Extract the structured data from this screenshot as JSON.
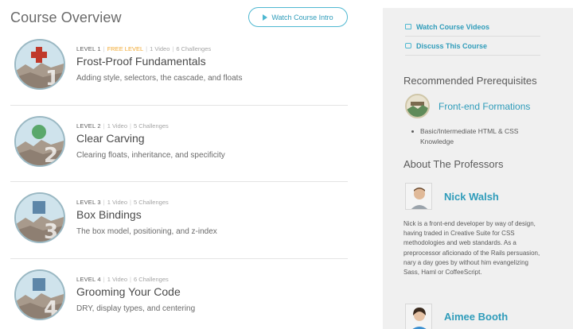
{
  "header": {
    "title": "Course Overview",
    "watch_intro_label": "Watch Course Intro"
  },
  "levels": [
    {
      "level": "LEVEL 1",
      "free": "FREE LEVEL",
      "videos": "1 Video",
      "challenges": "6 Challenges",
      "title": "Frost-Proof Fundamentals",
      "description": "Adding style, selectors, the cascade, and floats",
      "badge_icon": "red-cross-icon",
      "badge_number": "1",
      "badge_color": "#c0392b"
    },
    {
      "level": "LEVEL 2",
      "videos": "1 Video",
      "challenges": "5 Challenges",
      "title": "Clear Carving",
      "description": "Clearing floats, inheritance, and specificity",
      "badge_icon": "green-circle-icon",
      "badge_number": "2",
      "badge_color": "#5aa86b"
    },
    {
      "level": "LEVEL 3",
      "videos": "1 Video",
      "challenges": "5 Challenges",
      "title": "Box Bindings",
      "description": "The box model, positioning, and z-index",
      "badge_icon": "blue-square-icon",
      "badge_number": "3",
      "badge_color": "#5d86a8"
    },
    {
      "level": "LEVEL 4",
      "videos": "1 Video",
      "challenges": "6 Challenges",
      "title": "Grooming Your Code",
      "description": "DRY, display types, and centering",
      "badge_icon": "blue-square-icon",
      "badge_number": "4",
      "badge_color": "#5d86a8"
    }
  ],
  "sidebar": {
    "links": [
      {
        "label": "Watch Course Videos",
        "icon": "video-icon"
      },
      {
        "label": "Discuss This Course",
        "icon": "chat-bubble-icon"
      }
    ],
    "prereq_heading": "Recommended Prerequisites",
    "prereq_course": "Front-end Formations",
    "prereq_items": [
      "Basic/Intermediate HTML & CSS Knowledge"
    ],
    "professors_heading": "About The Professors",
    "professors": [
      {
        "name": "Nick Walsh",
        "bio": "Nick is a front-end developer by way of design, having traded in Creative Suite for CSS methodologies and web standards. As a preprocessor aficionado of the Rails persuasion, nary a day goes by without him evangelizing Sass, Haml or CoffeeScript."
      },
      {
        "name": "Aimee Booth",
        "bio": ""
      }
    ]
  },
  "colors": {
    "accent": "#2f9cba",
    "free_level": "#f0a830",
    "sidebar_bg": "#f0f0f0"
  }
}
